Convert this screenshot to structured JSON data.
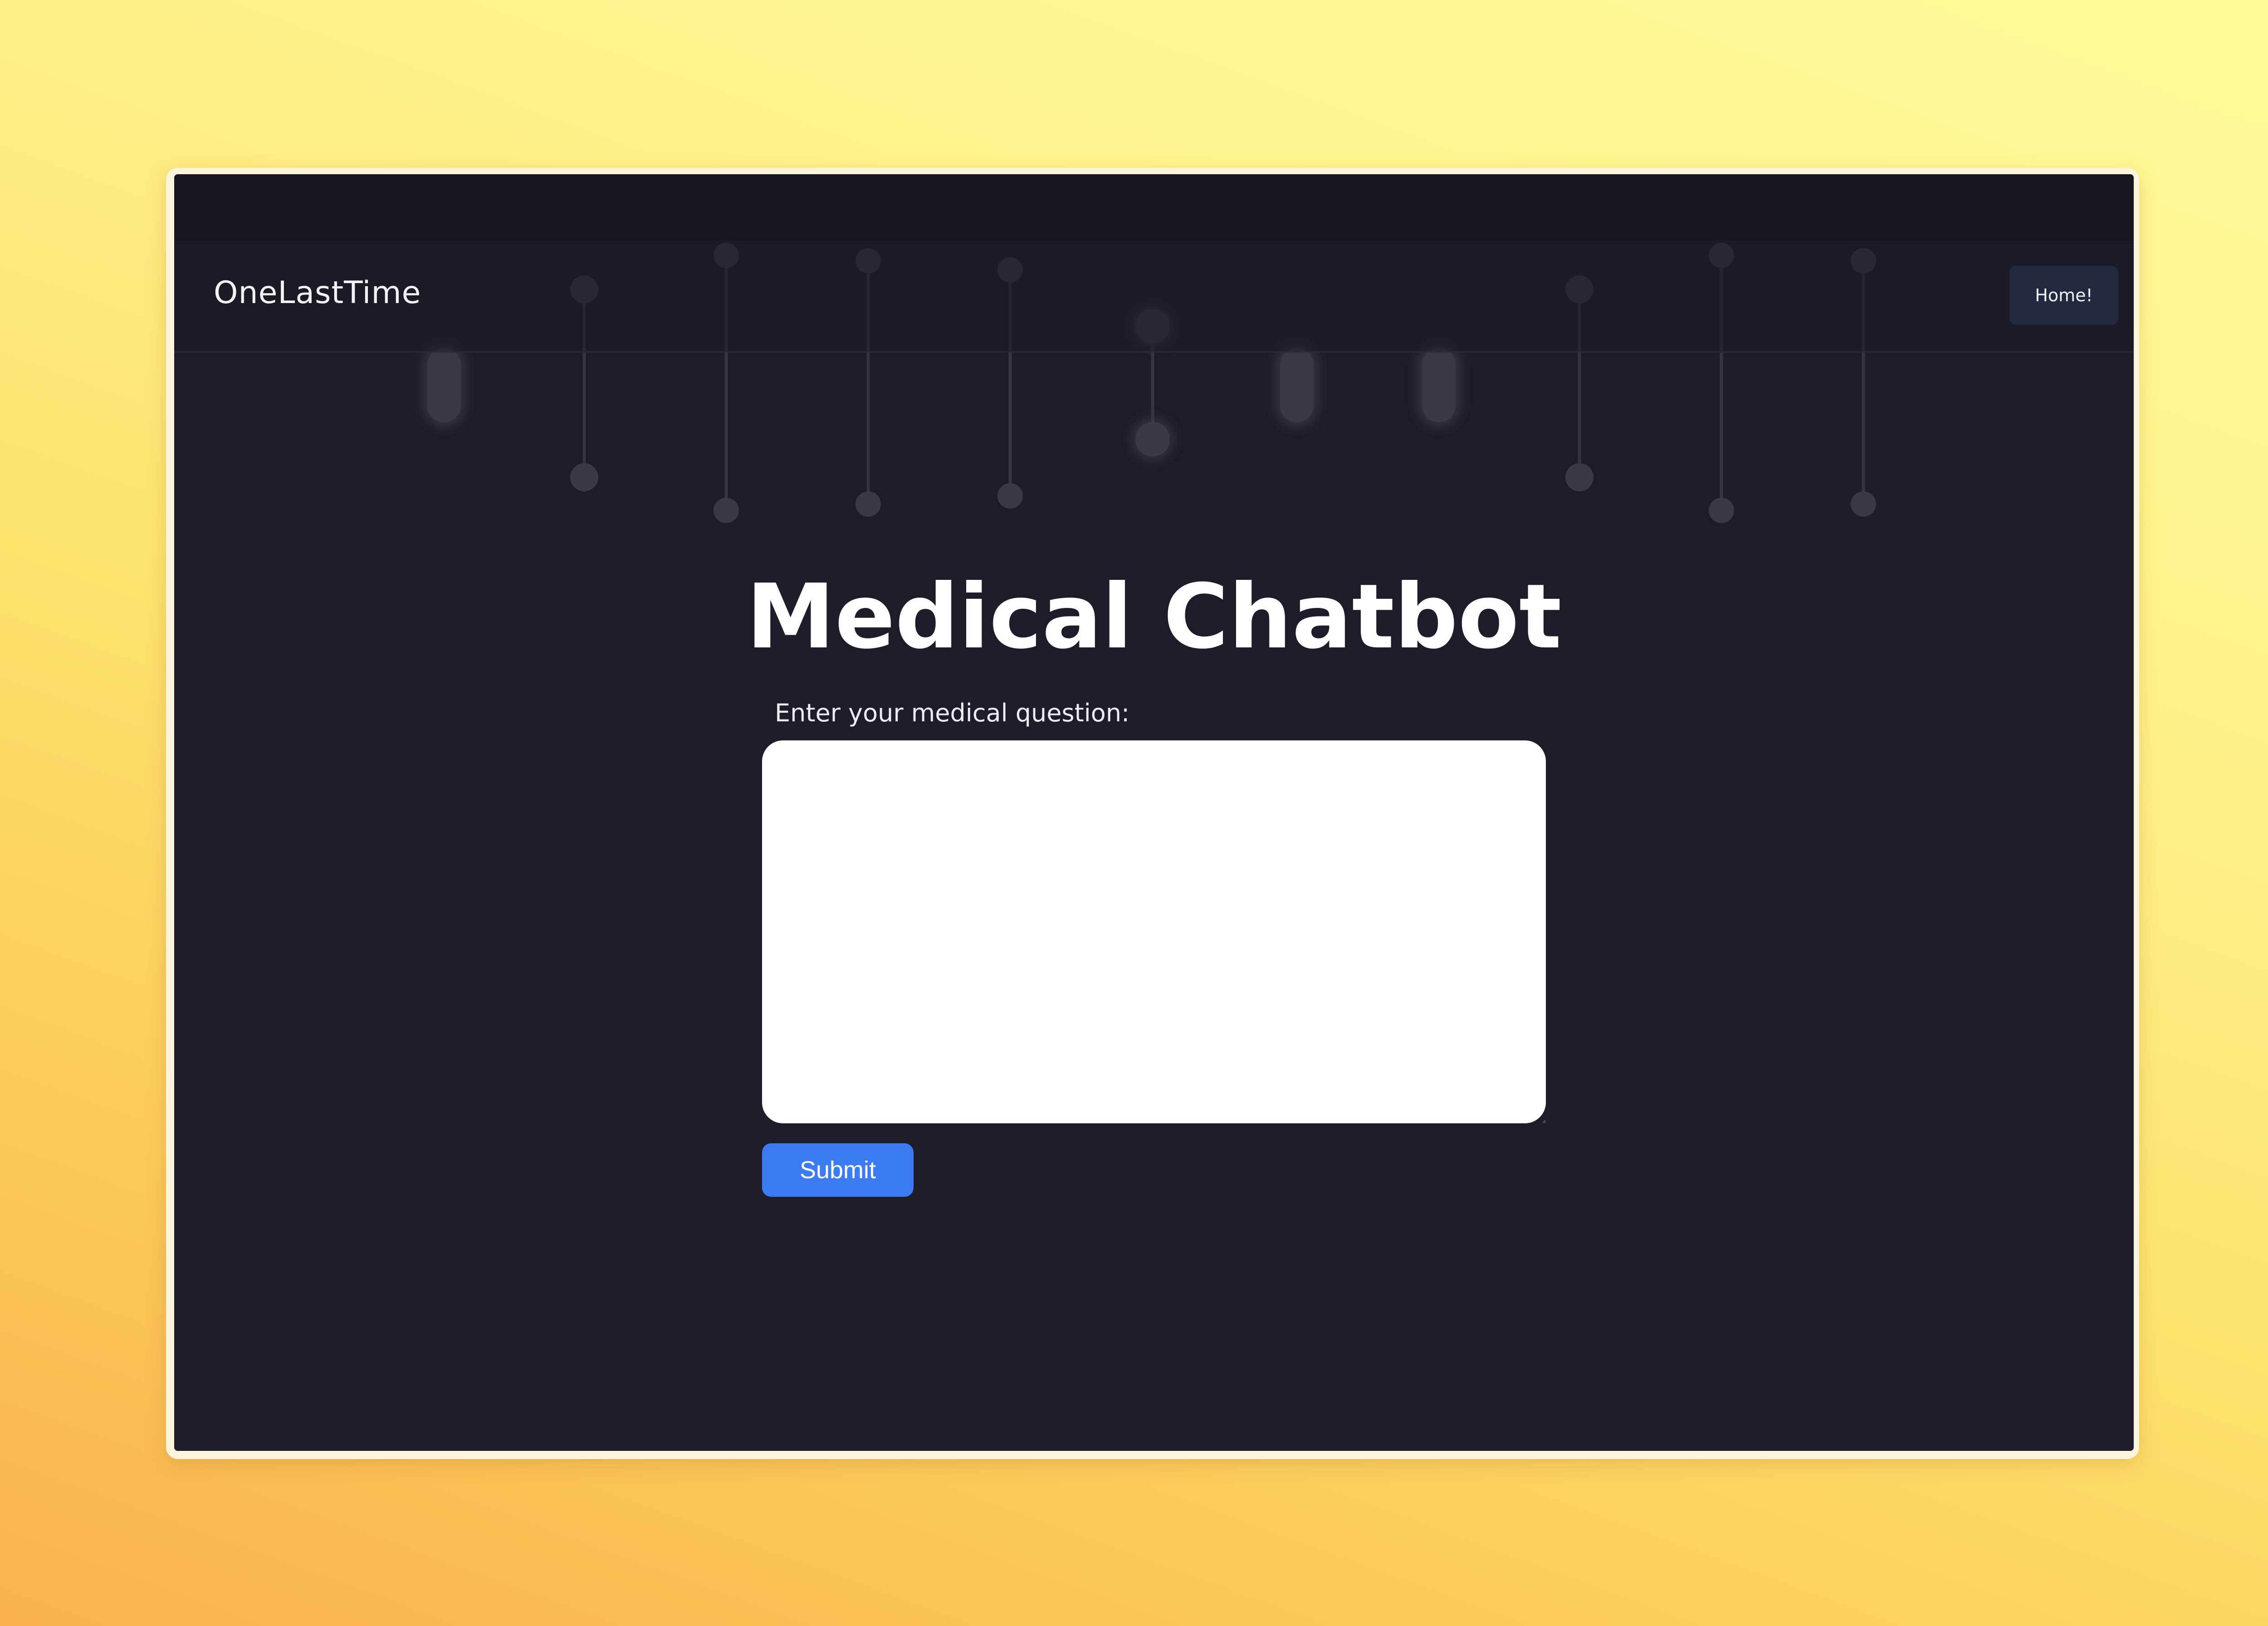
{
  "nav": {
    "brand": "OneLastTime",
    "home_label": "Home!"
  },
  "main": {
    "title": "Medical Chatbot",
    "question_label": "Enter your medical question:",
    "question_value": "",
    "question_placeholder": "",
    "submit_label": "Submit"
  },
  "colors": {
    "page_background": "#1d1c29",
    "accent": "#3b7cf4",
    "nav_button": "#222a3f"
  }
}
